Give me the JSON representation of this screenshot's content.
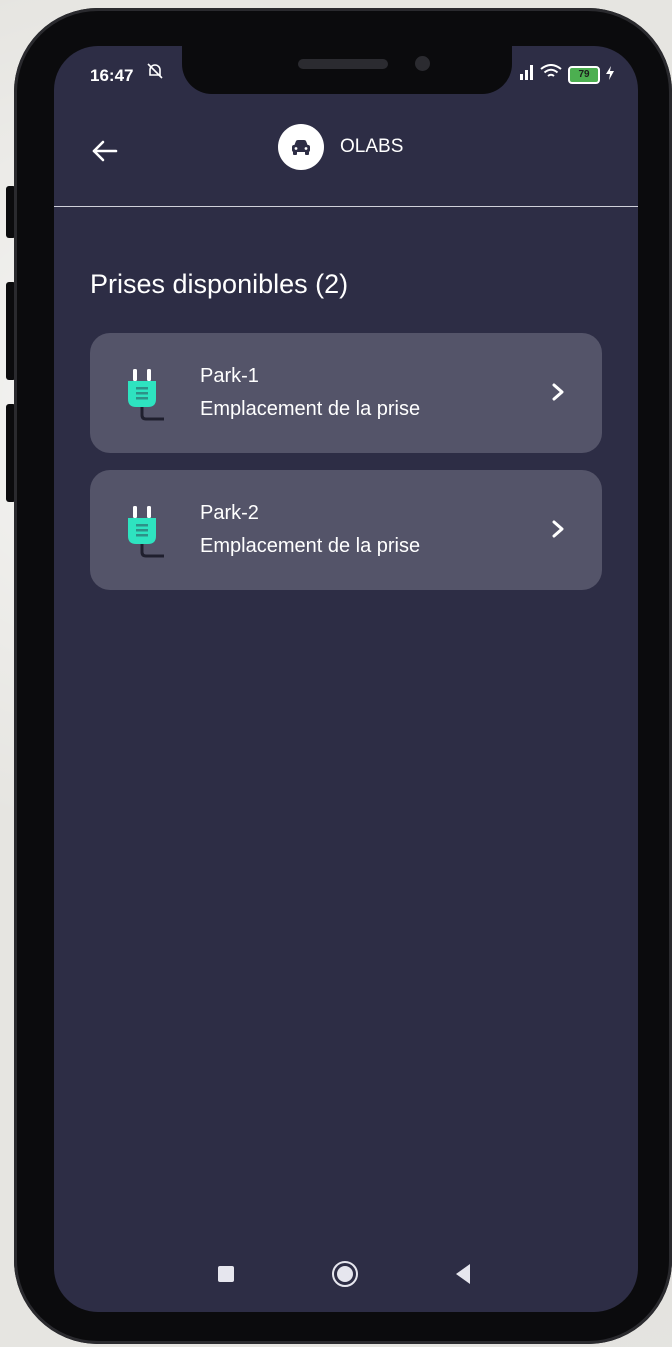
{
  "status_bar": {
    "time": "16:47",
    "battery": "79"
  },
  "header": {
    "brand_name": "OLABS"
  },
  "main": {
    "section_title": "Prises disponibles (2)",
    "outlets": [
      {
        "name": "Park-1",
        "subtitle": "Emplacement de la prise"
      },
      {
        "name": "Park-2",
        "subtitle": "Emplacement de la prise"
      }
    ]
  },
  "colors": {
    "background": "#2d2d45",
    "card": "#545469",
    "plug_accent": "#2ee3c0"
  },
  "icons": {
    "back": "arrow-left-icon",
    "brand": "car-icon",
    "outlet": "plug-icon",
    "chevron": "chevron-right-icon"
  }
}
